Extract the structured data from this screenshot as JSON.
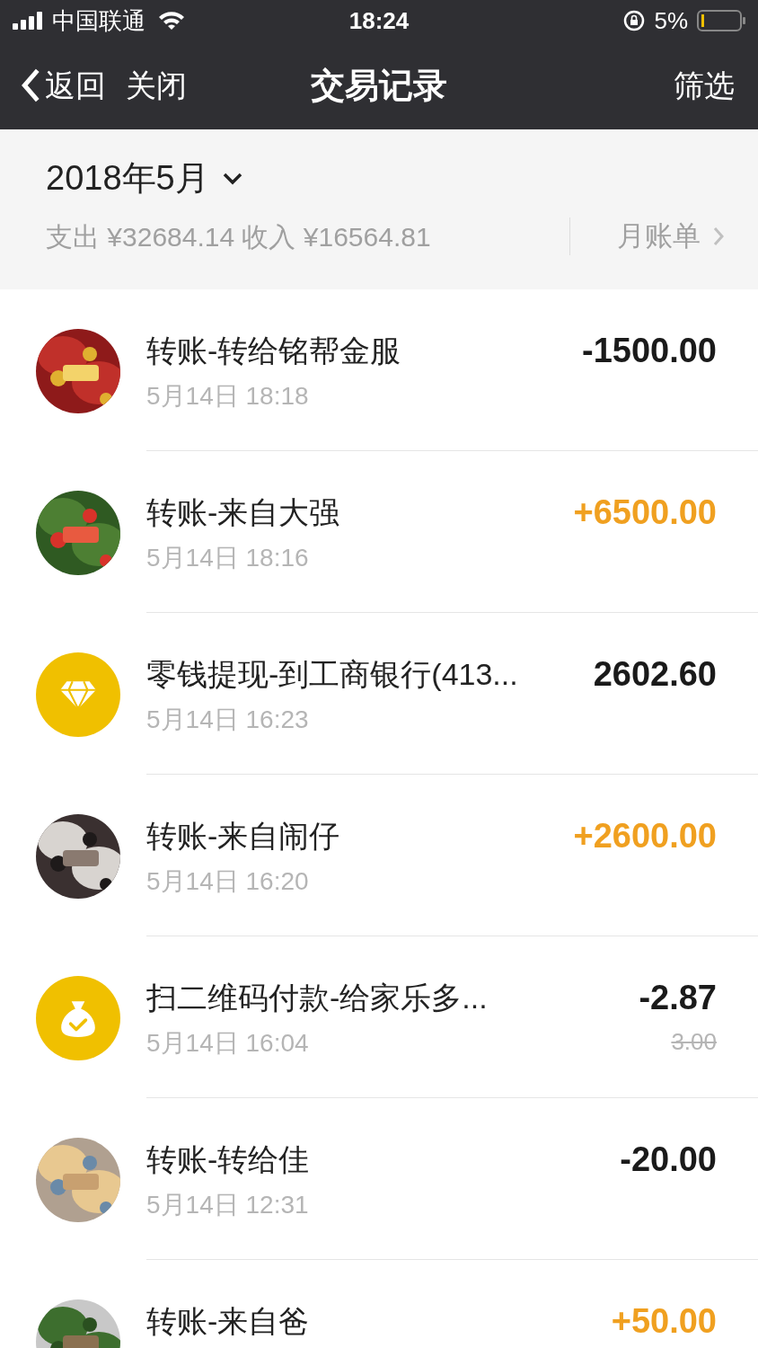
{
  "status_bar": {
    "carrier": "中国联通",
    "time": "18:24",
    "battery": "5%"
  },
  "nav": {
    "back": "返回",
    "close": "关闭",
    "title": "交易记录",
    "filter": "筛选"
  },
  "summary": {
    "month": "2018年5月",
    "totals": "支出 ¥32684.14 收入 ¥16564.81",
    "bill_link": "月账单"
  },
  "transactions": [
    {
      "title": "转账-转给铭帮金服",
      "time": "5月14日 18:18",
      "amount": "-1500.00",
      "kind": "expense"
    },
    {
      "title": "转账-来自大强",
      "time": "5月14日 18:16",
      "amount": "+6500.00",
      "kind": "income"
    },
    {
      "avatar": {
        "kind": "diamond"
      },
      "title": "零钱提现-到工商银行(413...",
      "time": "5月14日 16:23",
      "amount": "2602.60",
      "kind": "expense"
    },
    {
      "title": "转账-来自闹仔",
      "time": "5月14日 16:20",
      "amount": "+2600.00",
      "kind": "income"
    },
    {
      "avatar": {
        "kind": "moneybag"
      },
      "title": "扫二维码付款-给家乐多...",
      "time": "5月14日 16:04",
      "amount": "-2.87",
      "original_amount": "3.00",
      "kind": "expense"
    },
    {
      "title": "转账-转给佳",
      "time": "5月14日 12:31",
      "amount": "-20.00",
      "kind": "expense"
    },
    {
      "title": "转账-来自爸",
      "amount": "+50.00",
      "kind": "income"
    }
  ]
}
